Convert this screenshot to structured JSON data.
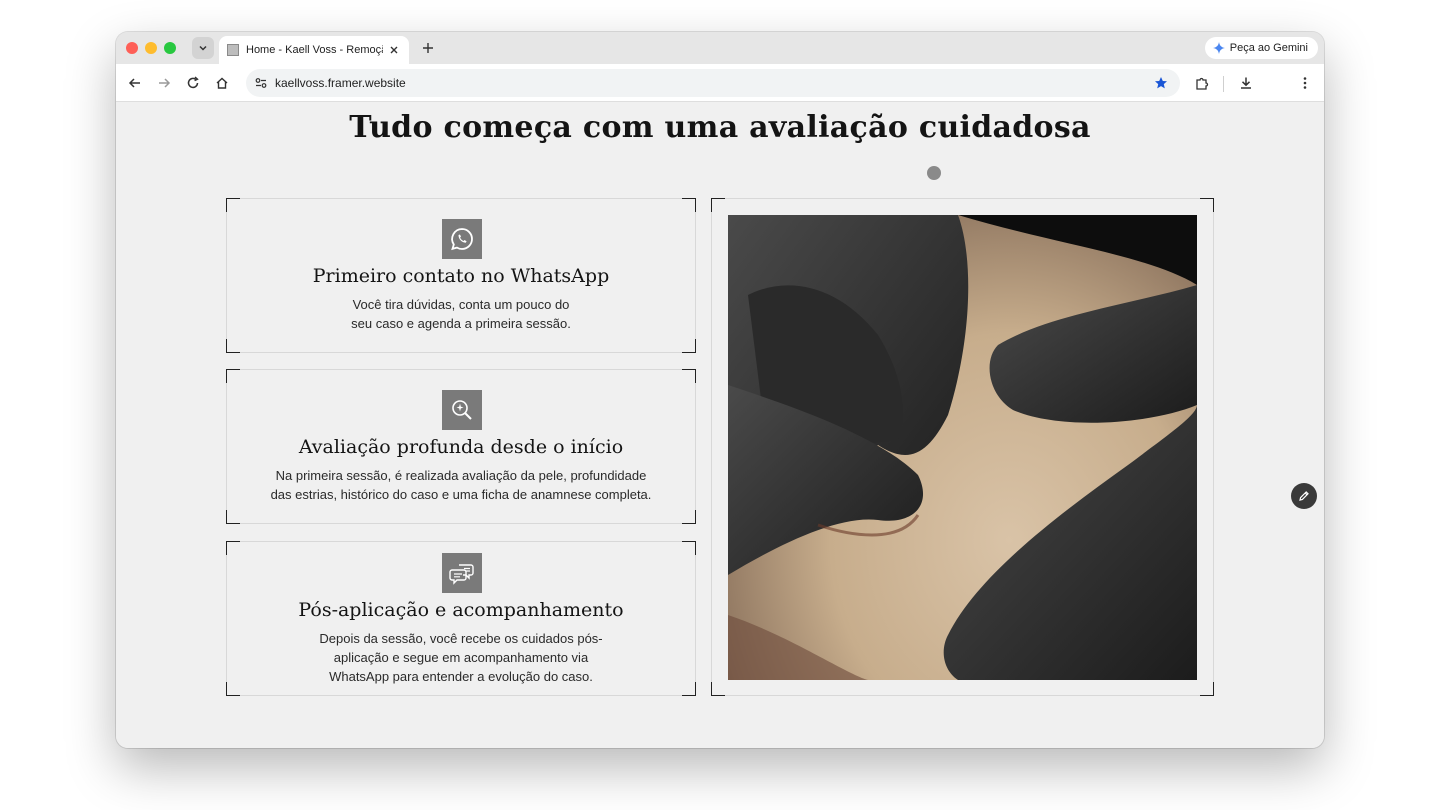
{
  "browser": {
    "tab_title": "Home - Kaell Voss - Remoção",
    "gemini_label": "Peça ao Gemini",
    "url": "kaellvoss.framer.website"
  },
  "page": {
    "title": "Tudo começa com uma avaliação cuidadosa",
    "cards": [
      {
        "icon": "whatsapp-icon",
        "title": "Primeiro contato no WhatsApp",
        "desc_lines": [
          "Você tira dúvidas, conta um pouco do",
          "seu caso e agenda a primeira sessão."
        ]
      },
      {
        "icon": "magnifier-sparkle-icon",
        "title": "Avaliação profunda desde o início",
        "desc_lines": [
          "Na primeira sessão, é realizada avaliação da pele, profundidade",
          "das estrias, histórico do caso e uma ficha de anamnese completa."
        ]
      },
      {
        "icon": "chat-bubbles-icon",
        "title": "Pós-aplicação e acompanhamento",
        "desc_lines": [
          "Depois da sessão, você recebe os cuidados pós-",
          "aplicação e segue em acompanhamento via",
          "WhatsApp para entender a evolução do caso."
        ]
      }
    ]
  }
}
